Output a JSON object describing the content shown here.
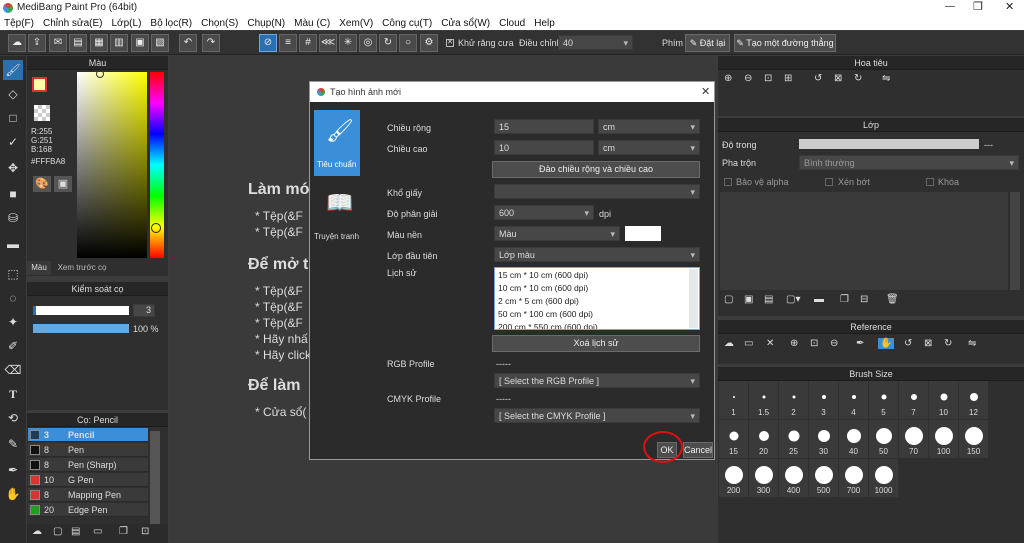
{
  "window": {
    "title": "MediBang Paint Pro (64bit)"
  },
  "menu": [
    "Tệp(F)",
    "Chỉnh sửa(E)",
    "Lớp(L)",
    "Bộ lọc(R)",
    "Chọn(S)",
    "Chụp(N)",
    "Màu (C)",
    "Xem(V)",
    "Công cụ(T)",
    "Cửa sổ(W)",
    "Cloud",
    "Help"
  ],
  "toolbar": {
    "antialias": "Khử răng cưa",
    "adjust_label": "Điều chỉnh",
    "adjust_value": "40",
    "snap_label": "Phím",
    "reset": "Đặt lại",
    "straight": "Tạo một đường thẳng"
  },
  "color_panel": {
    "title": "Màu",
    "r": "R:255",
    "g": "G:251",
    "b": "B:168",
    "hex": "#FFFBA8",
    "tab1": "Màu",
    "tab2": "Xem trước cọ",
    "fg": "#fffba8"
  },
  "brush_control": {
    "title": "Kiểm soát cọ",
    "size": "3",
    "opacity": "100 %"
  },
  "brush_list": {
    "title": "Cọ: Pencil",
    "items": [
      {
        "num": "3",
        "name": "Pencil",
        "color": "#1e3a5a"
      },
      {
        "num": "8",
        "name": "Pen",
        "color": "#111111"
      },
      {
        "num": "8",
        "name": "Pen (Sharp)",
        "color": "#111111"
      },
      {
        "num": "10",
        "name": "G Pen",
        "color": "#e03030"
      },
      {
        "num": "8",
        "name": "Mapping Pen",
        "color": "#e03030"
      },
      {
        "num": "20",
        "name": "Edge Pen",
        "color": "#20a020"
      }
    ]
  },
  "doc": {
    "h1": "Làm mớ",
    "l1": "* Tệp(&F",
    "l2": "* Tệp(&F",
    "h2": "Để mở t",
    "l3": "* Tệp(&F",
    "l4": "* Tệp(&F",
    "l5": "* Tệp(&F",
    "l6": "* Hãy nhấ",
    "l7": "* Hãy click",
    "h3": "Để làm",
    "l8": "* Cửa sổ("
  },
  "dialog": {
    "title": "Tạo hình ảnh mới",
    "mode_standard": "Tiêu chuẩn",
    "mode_comic": "Truyện tranh",
    "width_label": "Chiều rộng",
    "width_value": "15",
    "width_unit": "cm",
    "height_label": "Chiều cao",
    "height_value": "10",
    "height_unit": "cm",
    "swap": "Đảo chiều rộng và chiều cao",
    "paper_label": "Khổ giấy",
    "paper_value": "",
    "dpi_label": "Độ phân giải",
    "dpi_value": "600",
    "dpi_unit": "dpi",
    "bg_label": "Màu nền",
    "bg_value": "Màu",
    "bg_color": "#ffffff",
    "layer_label": "Lớp đầu tiên",
    "layer_value": "Lớp màu",
    "history_label": "Lịch sử",
    "history": [
      "15 cm * 10 cm (600 dpi)",
      "10 cm * 10 cm (600 dpi)",
      "2 cm * 5 cm (600 dpi)",
      "50 cm * 100 cm (600 dpi)",
      "200 cm * 550 cm (600 dpi)"
    ],
    "clear_history": "Xoá lịch sử",
    "rgb_label": "RGB Profile",
    "rgb_dash": "-----",
    "rgb_value": "[ Select the RGB Profile ]",
    "cmyk_label": "CMYK Profile",
    "cmyk_dash": "-----",
    "cmyk_value": "[ Select the CMYK Profile ]",
    "ok": "OK",
    "cancel": "Cancel"
  },
  "navigator": {
    "title": "Hoa tiêu"
  },
  "layer": {
    "title": "Lớp",
    "opacity_label": "Độ trong",
    "opacity_value": "---",
    "blend_label": "Pha trộn",
    "blend_value": "Bình thường",
    "protect": "Bảo vệ alpha",
    "clip": "Xén bớt",
    "lock": "Khóa"
  },
  "reference": {
    "title": "Reference"
  },
  "brush_size": {
    "title": "Brush Size",
    "sizes": [
      "1",
      "1.5",
      "2",
      "3",
      "4",
      "5",
      "7",
      "10",
      "12",
      "15",
      "20",
      "25",
      "30",
      "40",
      "50",
      "70",
      "100",
      "150",
      "200",
      "300",
      "400",
      "500",
      "700",
      "1000"
    ]
  }
}
